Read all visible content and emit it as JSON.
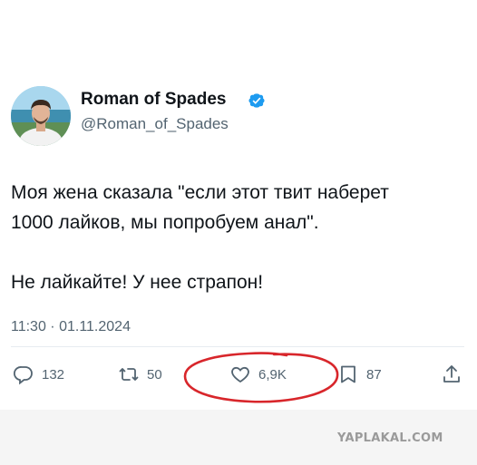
{
  "author": {
    "name": "Roman of Spades",
    "handle": "@Roman_of_Spades",
    "verified": true
  },
  "tweet": {
    "lines": [
      "Моя жена сказала \"если этот твит наберет",
      "1000 лайков, мы попробуем анал\".",
      "Не лайкайте! У нее страпон!"
    ],
    "timestamp": "11:30 · 01.11.2024"
  },
  "actions": {
    "replies": "132",
    "retweets": "50",
    "likes": "6,9K",
    "bookmarks": "87"
  },
  "watermark": "YAPLAKAL.COM",
  "colors": {
    "text": "#0f1419",
    "muted": "#536471",
    "verified_badge": "#1d9bf0",
    "highlight_oval": "#d8262b",
    "footer_background": "#f5f5f5"
  }
}
